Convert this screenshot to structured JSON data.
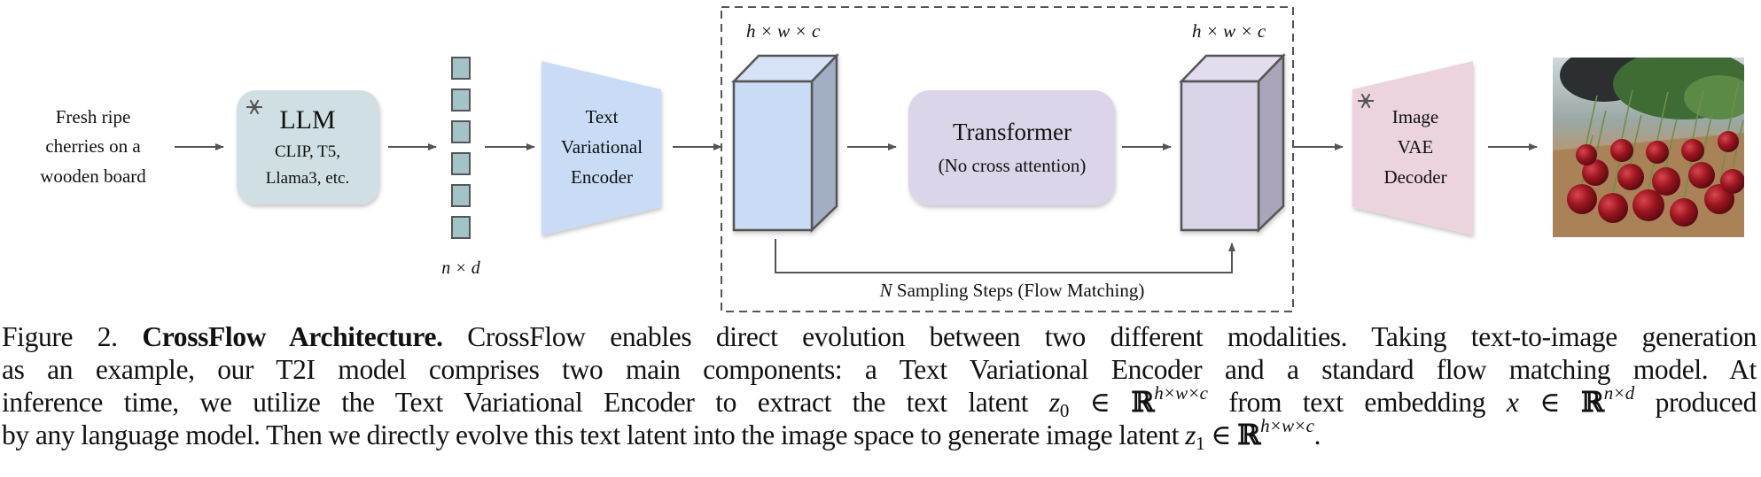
{
  "figure": {
    "input_prompt": [
      "Fresh ripe",
      "cherries on a",
      "wooden board"
    ],
    "llm_box": {
      "title": "LLM",
      "subtitle_lines": [
        "CLIP, T5,",
        "Llama3, etc."
      ],
      "frozen_icon": "snowflake-icon",
      "color": "#d0dfe3"
    },
    "token_stack": {
      "count": 6,
      "label": "n × d",
      "color": "#a3c4c6"
    },
    "text_encoder": {
      "lines": [
        "Text",
        "Variational",
        "Encoder"
      ],
      "color": "#c9dbf5"
    },
    "latent_source": {
      "label": "h × w × c",
      "front_color": "#c9dbf5",
      "top_color": "#d6e3f7",
      "side_color": "#a1aec4"
    },
    "transformer": {
      "title": "Transformer",
      "subtitle": "(No cross attention)",
      "color": "#dcd4e8"
    },
    "latent_target": {
      "label": "h × w × c",
      "front_color": "#dad3e7",
      "top_color": "#e2dcee",
      "side_color": "#aaa5b9"
    },
    "loop_label_italic": "N",
    "loop_label": " Sampling Steps (Flow Matching)",
    "image_decoder": {
      "lines": [
        "Image",
        "VAE",
        "Decoder"
      ],
      "frozen_icon": "snowflake-icon",
      "color": "#ebd4de"
    },
    "output_image": {
      "description": "generated image of red cherries with stems on a wooden board"
    },
    "arrow_color": "#555555",
    "dashed_box_color": "#555555"
  },
  "caption": {
    "label": "Figure 2.",
    "title": "CrossFlow Architecture.",
    "line1_rest": "CrossFlow enables direct evolution between two different modalities. Taking text-to-image generation",
    "line2": "as an example, our T2I model comprises two main components: a Text Variational Encoder and a standard flow matching model.  At",
    "line3_a": "inference time, we utilize the Text Variational Encoder to extract the text latent ",
    "line3_z0": "z",
    "line3_z0_sub": "0",
    "in_symbol": " ∈ ",
    "reals": "ℝ",
    "hwc": "h×w×c",
    "line3_b": " from text embedding ",
    "line3_x": "x",
    "nd": "n×d",
    "line3_c": " produced",
    "line4_a": "by any language model. Then we directly evolve this text latent into the image space to generate image latent ",
    "line4_z1": "z",
    "line4_z1_sub": "1",
    "line4_end": "."
  }
}
